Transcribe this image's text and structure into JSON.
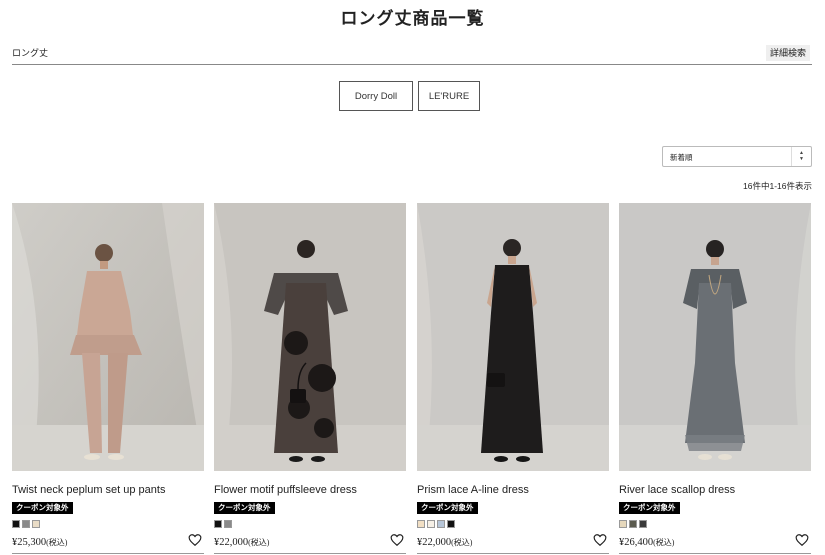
{
  "page": {
    "title": "ロング丈商品一覧"
  },
  "search": {
    "keyword": "ロング丈",
    "detail_label": "詳細検索"
  },
  "brands": [
    "Dorry Doll",
    "LE'RURE"
  ],
  "sort": {
    "selected": "新着順",
    "arrow_up": "▲",
    "arrow_down": "▼"
  },
  "result_count": "16件中1-16件表示",
  "products": [
    {
      "name": "Twist neck peplum set up pants",
      "badge": "クーポン対象外",
      "swatches": [
        "#111111",
        "#8a8a8a",
        "#e9dcc6"
      ],
      "price": "¥25,300",
      "tax": "(税込)"
    },
    {
      "name": "Flower motif puffsleeve dress",
      "badge": "クーポン対象外",
      "swatches": [
        "#111111",
        "#8a8a8a"
      ],
      "price": "¥22,000",
      "tax": "(税込)"
    },
    {
      "name": "Prism lace A-line dress",
      "badge": "クーポン対象外",
      "swatches": [
        "#f1dfc4",
        "#f6f0e6",
        "#b7c6d8",
        "#111111"
      ],
      "price": "¥22,000",
      "tax": "(税込)"
    },
    {
      "name": "River lace scallop dress",
      "badge": "クーポン対象外",
      "swatches": [
        "#e6d8bc",
        "#5b5b4f",
        "#3a3a3a"
      ],
      "price": "¥26,400",
      "tax": "(税込)"
    }
  ]
}
